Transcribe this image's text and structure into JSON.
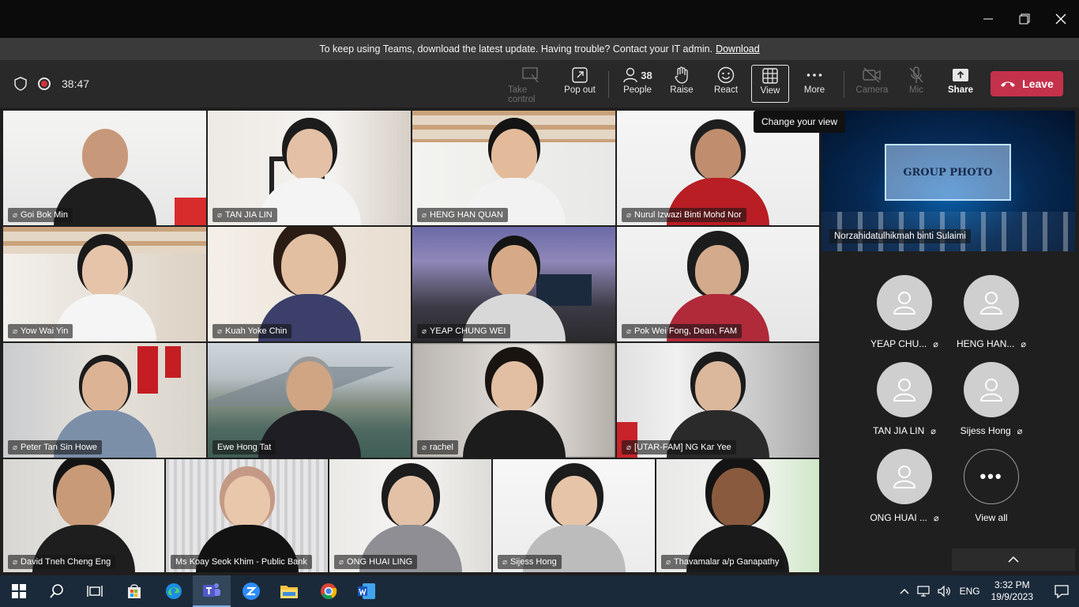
{
  "banner": {
    "message": "To keep using Teams, download the latest update. Having trouble? Contact your IT admin.",
    "link": "Download"
  },
  "meeting": {
    "timer": "38:47"
  },
  "toolbar": {
    "take_control": "Take control",
    "pop_out": "Pop out",
    "people_count": "38",
    "people": "People",
    "raise": "Raise",
    "react": "React",
    "view": "View",
    "more": "More",
    "camera": "Camera",
    "mic": "Mic",
    "share": "Share",
    "leave": "Leave"
  },
  "tooltip": "Change your view",
  "participants": [
    {
      "name": "Goi Bok Min"
    },
    {
      "name": "TAN JIA LIN"
    },
    {
      "name": "HENG HAN QUAN"
    },
    {
      "name": "Nurul Izwazi Binti Mohd Nor"
    },
    {
      "name": "Yow Wai Yin"
    },
    {
      "name": "Kuah Yoke Chin"
    },
    {
      "name": "YEAP CHUNG WEI"
    },
    {
      "name": "Pok Wei Fong, Dean, FAM"
    },
    {
      "name": "Peter Tan Sin Howe"
    },
    {
      "name": "Ewe Hong Tat"
    },
    {
      "name": "rachel"
    },
    {
      "name": "[UTAR-FAM] NG Kar Yee"
    },
    {
      "name": "David Tneh Cheng Eng"
    },
    {
      "name": "Ms Koay Seok Khim - Public Bank"
    },
    {
      "name": "ONG HUAI LING"
    },
    {
      "name": "Sijess Hong"
    },
    {
      "name": "Thavamalar a/p Ganapathy"
    }
  ],
  "featured": {
    "name": "Norzahidatulhikmah binti Sulaimi",
    "slide_text": "GROUP PHOTO"
  },
  "side_avatars": [
    {
      "name": "YEAP CHU..."
    },
    {
      "name": "HENG HAN..."
    },
    {
      "name": "TAN JIA LIN"
    },
    {
      "name": "Sijess Hong"
    },
    {
      "name": "ONG HUAI ..."
    }
  ],
  "view_all": "View all",
  "taskbar": {
    "language": "ENG",
    "time": "3:32 PM",
    "date": "19/9/2023"
  },
  "colors": {
    "leave": "#c4314b",
    "record": "#d13438",
    "taskbar": "#1b2a3a"
  }
}
